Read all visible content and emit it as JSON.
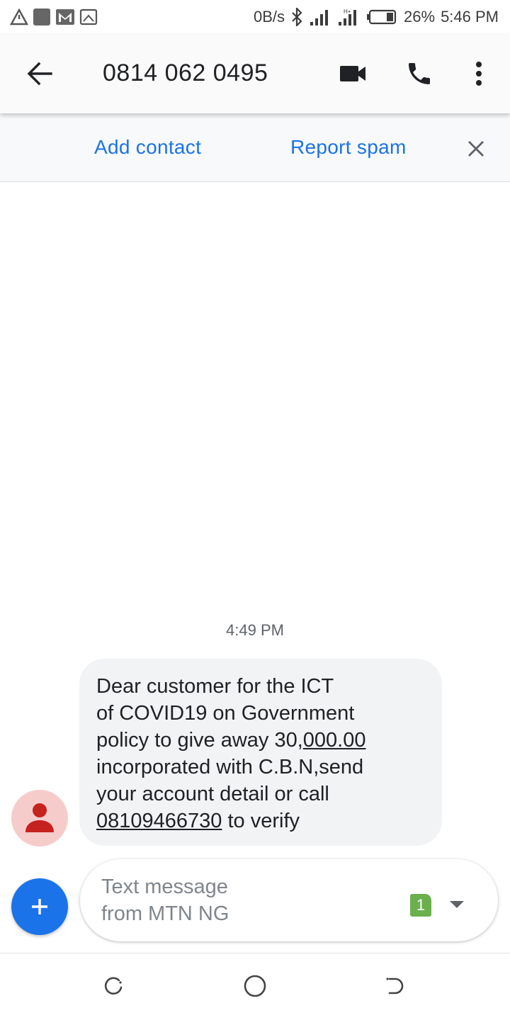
{
  "status_bar": {
    "net_speed": "0B/s",
    "battery_percent": "26%",
    "time": "5:46 PM"
  },
  "toolbar": {
    "title": "0814 062 0495"
  },
  "spam_banner": {
    "add_contact_label": "Add contact",
    "report_spam_label": "Report spam"
  },
  "conversation": {
    "timestamp": "4:49 PM",
    "message": {
      "line1": "Dear customer for the ICT",
      "line2": "of COVID19 on Government",
      "line3_prefix": "policy to give away 30,",
      "line3_link": "000.00",
      "line4": "incorporated with C.B.N,send",
      "line5": "your account detail or call",
      "line6_link": "08109466730",
      "line6_suffix": " to verify"
    }
  },
  "compose": {
    "placeholder_line1": "Text message",
    "placeholder_line2": "from MTN NG",
    "sim_slot": "1"
  },
  "colors": {
    "accent": "#1a73e8",
    "avatar_bg": "#f6cccb",
    "avatar_fg": "#c5221f",
    "sim_badge": "#6ab04c",
    "bubble_bg": "#f1f3f4"
  },
  "icons": {
    "status_left": [
      "warning-triangle-icon",
      "notification-square-icon",
      "gmail-icon",
      "screenshot-icon"
    ],
    "status_right": [
      "bluetooth-icon",
      "signal-icon",
      "signal-icon",
      "battery-icon"
    ],
    "toolbar": [
      "back-arrow-icon",
      "video-call-icon",
      "phone-icon",
      "more-vert-icon"
    ],
    "nav": [
      "recents-icon",
      "home-icon",
      "back-icon"
    ]
  }
}
